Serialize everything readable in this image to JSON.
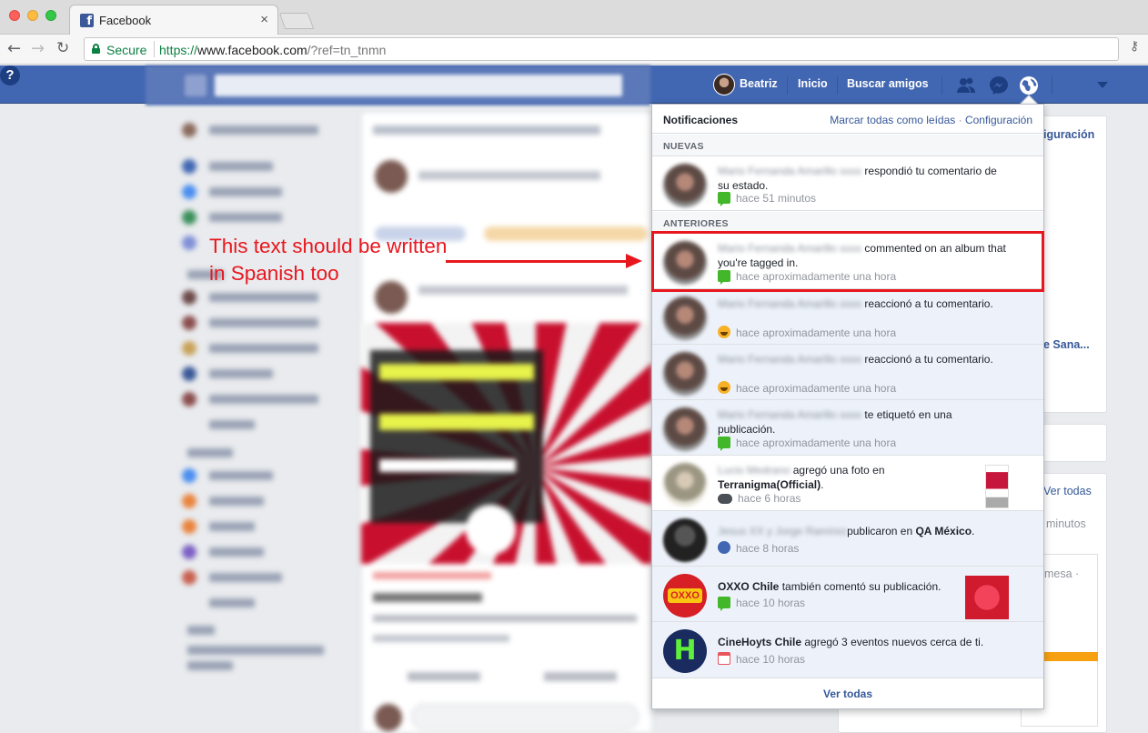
{
  "browser": {
    "tab_title": "Facebook",
    "tab_close": "×",
    "secure_label": "Secure",
    "url_proto": "https://",
    "url_host": "www.facebook.com",
    "url_path": "/?ref=tn_tnmn"
  },
  "header": {
    "user_name": "Beatriz",
    "home_label": "Inicio",
    "find_friends_label": "Buscar amigos",
    "help_glyph": "?"
  },
  "background_peek": {
    "configuracion": "iguración",
    "sana": "e Sana...",
    "ver_todas": "Ver todas",
    "minutos": "minutos",
    "mesa": "mesa ·"
  },
  "notifications": {
    "title": "Notificaciones",
    "mark_all_read": "Marcar todas como leídas",
    "separator": " · ",
    "settings": "Configuración",
    "section_new": "NUEVAS",
    "section_earlier": "ANTERIORES",
    "footer": "Ver todas",
    "items": [
      {
        "name": "Mario Fernanda Amarillo xxxx",
        "text": "respondió tu comentario de su estado.",
        "time": "hace 51 minutos",
        "icon": "comment-icon"
      },
      {
        "name": "Mario Fernanda Amarillo xxxx",
        "text": "commented on an album that you're tagged in.",
        "time": "hace aproximadamente una hora",
        "icon": "comment-icon"
      },
      {
        "name": "Mario Fernanda Amarillo xxxx",
        "text": "reaccionó a tu comentario.",
        "time": "hace aproximadamente una hora",
        "icon": "haha-icon"
      },
      {
        "name": "Mario Fernanda Amarillo xxxx",
        "text": "reaccionó a tu comentario.",
        "time": "hace aproximadamente una hora",
        "icon": "haha-icon"
      },
      {
        "name": "Mario Fernanda Amarillo xxxx",
        "text": "te etiquetó en una publicación.",
        "time": "hace aproximadamente una hora",
        "icon": "comment-icon"
      },
      {
        "name": "Lucio Medrano",
        "text": "agregó una foto en",
        "target": "Terranigma(Official)",
        "suffix": ".",
        "time": "hace 6 horas",
        "icon": "gamepad-icon"
      },
      {
        "name": "Jesus XX y Jorge Ramírez",
        "text": "publicaron en",
        "target": "QA México",
        "suffix": ".",
        "time": "hace 8 horas",
        "icon": "group-icon"
      },
      {
        "name": "OXXO Chile",
        "text": "también comentó su publicación.",
        "time": "hace 10 horas",
        "icon": "comment-icon",
        "avatar_text": "OXXO"
      },
      {
        "name": "CineHoyts Chile",
        "text": "agregó 3 eventos nuevos cerca de ti.",
        "time": "hace 10 horas",
        "icon": "calendar-icon",
        "avatar_text": "H"
      }
    ]
  },
  "annotation": {
    "text": "This text should be written in Spanish too",
    "color": "#e8171e"
  }
}
